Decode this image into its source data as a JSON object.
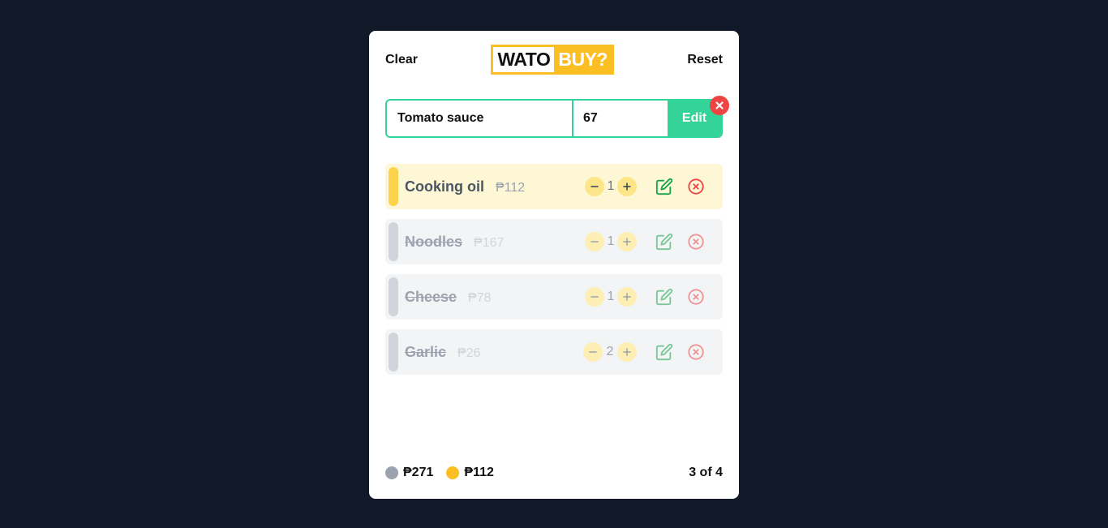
{
  "header": {
    "clear_label": "Clear",
    "reset_label": "Reset",
    "logo_part1": "WATO",
    "logo_part2": "BUY?"
  },
  "form": {
    "name_value": "Tomato sauce",
    "price_value": "67",
    "submit_label": "Edit"
  },
  "items": [
    {
      "name": "Cooking oil",
      "price": "₱112",
      "qty": "1",
      "active": true
    },
    {
      "name": "Noodles",
      "price": "₱167",
      "qty": "1",
      "active": false
    },
    {
      "name": "Cheese",
      "price": "₱78",
      "qty": "1",
      "active": false
    },
    {
      "name": "Garlic",
      "price": "₱26",
      "qty": "2",
      "active": false
    }
  ],
  "footer": {
    "done_total": "₱271",
    "pending_total": "₱112",
    "progress": "3 of 4"
  },
  "colors": {
    "accent_green": "#34d399",
    "accent_yellow": "#fbbf24",
    "danger": "#ef4444",
    "done_dot": "#9ca3af"
  }
}
